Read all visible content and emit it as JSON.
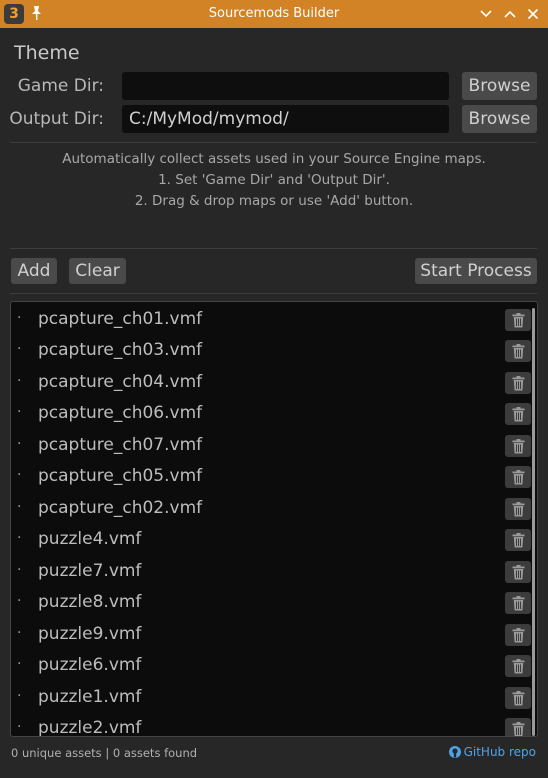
{
  "window": {
    "title": "Sourcemods Builder",
    "app_icon": "3",
    "accent": "#d18325"
  },
  "theme_label": "Theme",
  "game_dir": {
    "label": "Game Dir:",
    "value": "",
    "browse_label": "Browse"
  },
  "output_dir": {
    "label": "Output Dir:",
    "value": "C:/MyMod/mymod/",
    "browse_label": "Browse"
  },
  "instructions": {
    "line1": "Automatically collect assets used in your Source Engine maps.",
    "line2": "1. Set 'Game Dir' and 'Output Dir'.",
    "line3": "2. Drag & drop maps or use 'Add' button."
  },
  "toolbar": {
    "add_label": "Add",
    "clear_label": "Clear",
    "start_label": "Start Process"
  },
  "bullet": "·",
  "files": [
    "pcapture_ch01.vmf",
    "pcapture_ch03.vmf",
    "pcapture_ch04.vmf",
    "pcapture_ch06.vmf",
    "pcapture_ch07.vmf",
    "pcapture_ch05.vmf",
    "pcapture_ch02.vmf",
    "puzzle4.vmf",
    "puzzle7.vmf",
    "puzzle8.vmf",
    "puzzle9.vmf",
    "puzzle6.vmf",
    "puzzle1.vmf",
    "puzzle2.vmf"
  ],
  "status": {
    "text": "0 unique assets | 0 assets found"
  },
  "github": {
    "label": "GitHub repo",
    "color": "#4ea3e8"
  }
}
